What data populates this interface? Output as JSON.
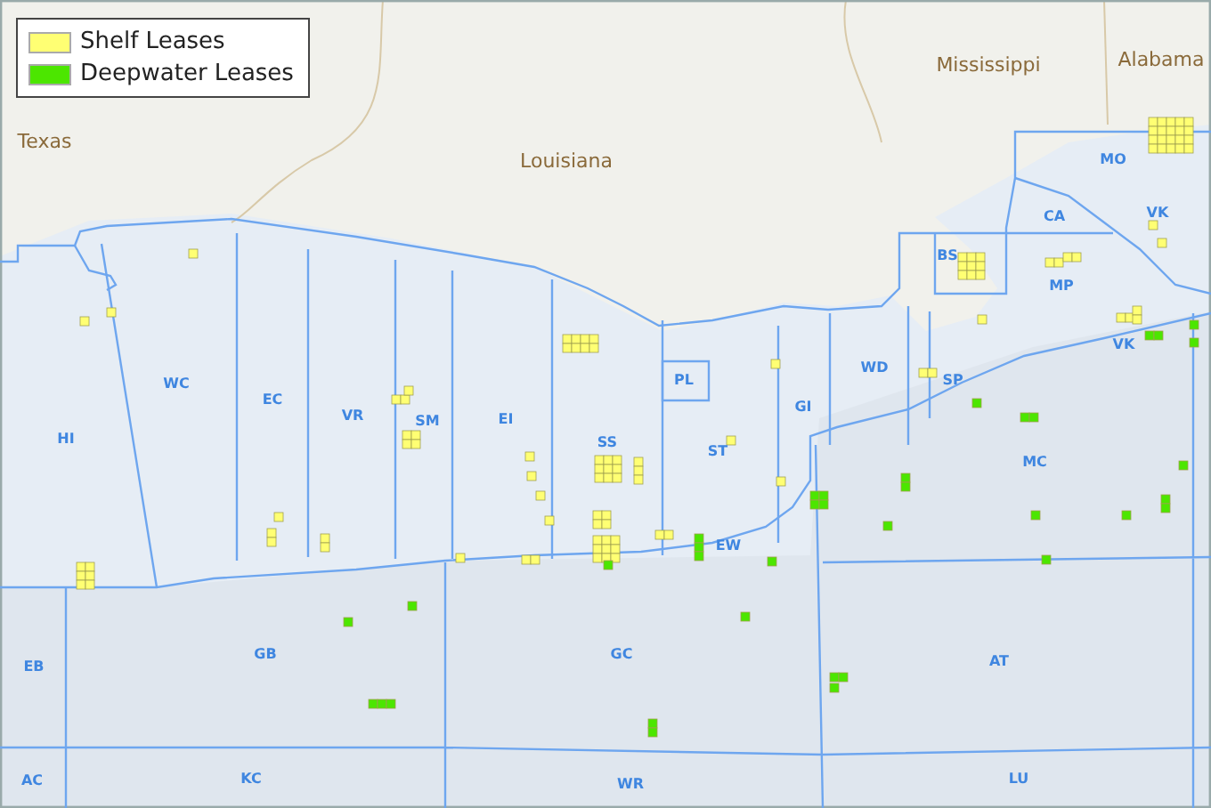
{
  "legend": {
    "items": [
      {
        "label": "Shelf Leases",
        "color": "#ffff73"
      },
      {
        "label": "Deepwater Leases",
        "color": "#4ce600"
      }
    ]
  },
  "state_labels": [
    "Texas",
    "Louisiana",
    "Mississippi",
    "Alabama"
  ],
  "area_labels": [
    "HI",
    "WC",
    "EC",
    "VR",
    "SM",
    "EI",
    "SS",
    "PL",
    "ST",
    "GI",
    "WD",
    "SP",
    "BS",
    "CA",
    "MO",
    "VK",
    "MP",
    "VK",
    "MC",
    "EW",
    "EB",
    "GB",
    "GC",
    "AT",
    "AC",
    "KC",
    "WR",
    "LU"
  ]
}
